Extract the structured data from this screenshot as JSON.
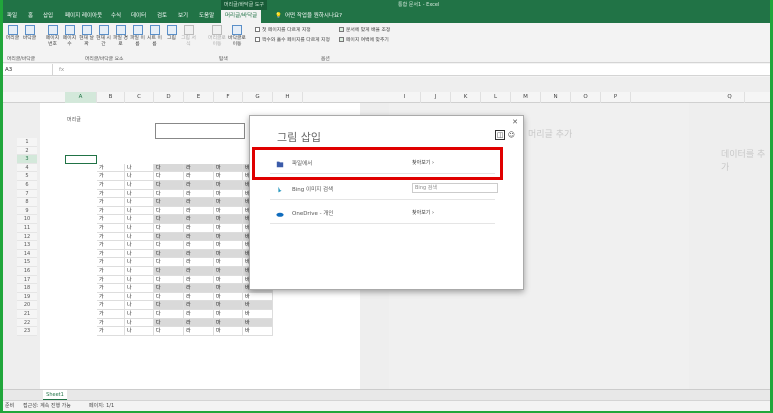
{
  "app": {
    "window_title": "통합 문서1 - Excel",
    "context_tab": "머리글/바닥글 도구"
  },
  "menu": {
    "items": [
      "파일",
      "홈",
      "삽입",
      "페이지 레이아웃",
      "수식",
      "데이터",
      "검토",
      "보기",
      "도움말",
      "머리글/바닥글"
    ],
    "tellme": "어떤 작업을 원하시나요?"
  },
  "ribbon": {
    "buttons": [
      "머리글",
      "바닥글",
      "페이지 번호",
      "페이지 수",
      "현재 날짜",
      "현재 시간",
      "파일 경로",
      "파일 이름",
      "시트 이름",
      "그림",
      "그림 서식",
      "머리글로 이동",
      "바닥글로 이동"
    ],
    "groups": [
      "머리글/바닥글",
      "머리글/바닥글 요소",
      "탐색",
      "옵션"
    ],
    "options": [
      "첫 페이지를 다르게 지정",
      "짝수와 홀수 페이지를 다르게 지정",
      "문서에 맞게 배율 조정",
      "페이지 여백에 맞추기"
    ]
  },
  "formula_bar": {
    "name_box": "A3",
    "fx": "fx"
  },
  "columns": [
    "A",
    "B",
    "C",
    "D",
    "E",
    "F",
    "G",
    "H",
    "I",
    "J",
    "K",
    "L",
    "M",
    "N",
    "O",
    "P",
    "Q"
  ],
  "rows": [
    "1",
    "2",
    "3",
    "4",
    "5",
    "6",
    "7",
    "8",
    "9",
    "10",
    "11",
    "12",
    "13",
    "14",
    "15",
    "16",
    "17",
    "18",
    "19",
    "20",
    "21",
    "22",
    "23"
  ],
  "cell_values": [
    "가",
    "나",
    "다",
    "라",
    "마",
    "바"
  ],
  "header_label": "머리글",
  "add_header_text": "머리글 추가",
  "add_data_text": "데이터를 추가",
  "sheet_tab": "Sheet1",
  "status": {
    "left": "준비",
    "accessibility": "접근성: 계속 진행 가능",
    "page": "페이지: 1/1"
  },
  "dialog": {
    "title": "그림 삽입",
    "rows": [
      {
        "label": "파일에서",
        "action": "찾아보기 ›"
      },
      {
        "label": "Bing 이미지 검색",
        "action": "Bing 검색"
      },
      {
        "label": "OneDrive - 개인",
        "action": "찾아보기 ›"
      }
    ]
  },
  "colors": {
    "excel_green": "#217346",
    "highlight_red": "#e00000",
    "border_green": "#21a63b"
  }
}
